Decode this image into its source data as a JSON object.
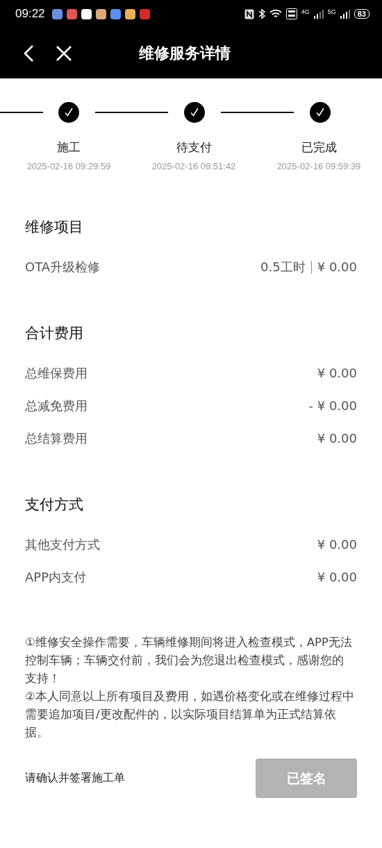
{
  "status_bar": {
    "time": "09:22",
    "battery": "83",
    "network_1": "4G",
    "network_2": "5G"
  },
  "header": {
    "title": "维修服务详情"
  },
  "steps": [
    {
      "label": "施工",
      "time": "2025-02-16 09:29:59",
      "done": true
    },
    {
      "label": "待支付",
      "time": "2025-02-16 09:51:42",
      "done": true
    },
    {
      "label": "已完成",
      "time": "2025-02-16 09:59:39",
      "done": true
    }
  ],
  "sections": [
    {
      "title": "维修项目",
      "rows": [
        {
          "label": "OTA升级检修",
          "hours": "0.5工时",
          "value": "¥ 0.00"
        }
      ]
    },
    {
      "title": "合计费用",
      "rows": [
        {
          "label": "总维保费用",
          "value": "¥ 0.00"
        },
        {
          "label": "总减免费用",
          "value": "- ¥ 0.00"
        },
        {
          "label": "总结算费用",
          "value": "¥ 0.00"
        }
      ]
    },
    {
      "title": "支付方式",
      "rows": [
        {
          "label": "其他支付方式",
          "value": "¥ 0.00"
        },
        {
          "label": "APP内支付",
          "value": "¥ 0.00"
        }
      ]
    }
  ],
  "notes": [
    "①维修安全操作需要，车辆维修期间将进入检查模式，APP无法控制车辆；车辆交付前，我们会为您退出检查模式，感谢您的支持！",
    "②本人同意以上所有项目及费用，如遇价格变化或在维修过程中需要追加项目/更改配件的，以实际项目结算单为正式结算依据。"
  ],
  "footer": {
    "prompt": "请确认并签署施工单",
    "button": {
      "label": "已签名",
      "disabled": true
    }
  }
}
